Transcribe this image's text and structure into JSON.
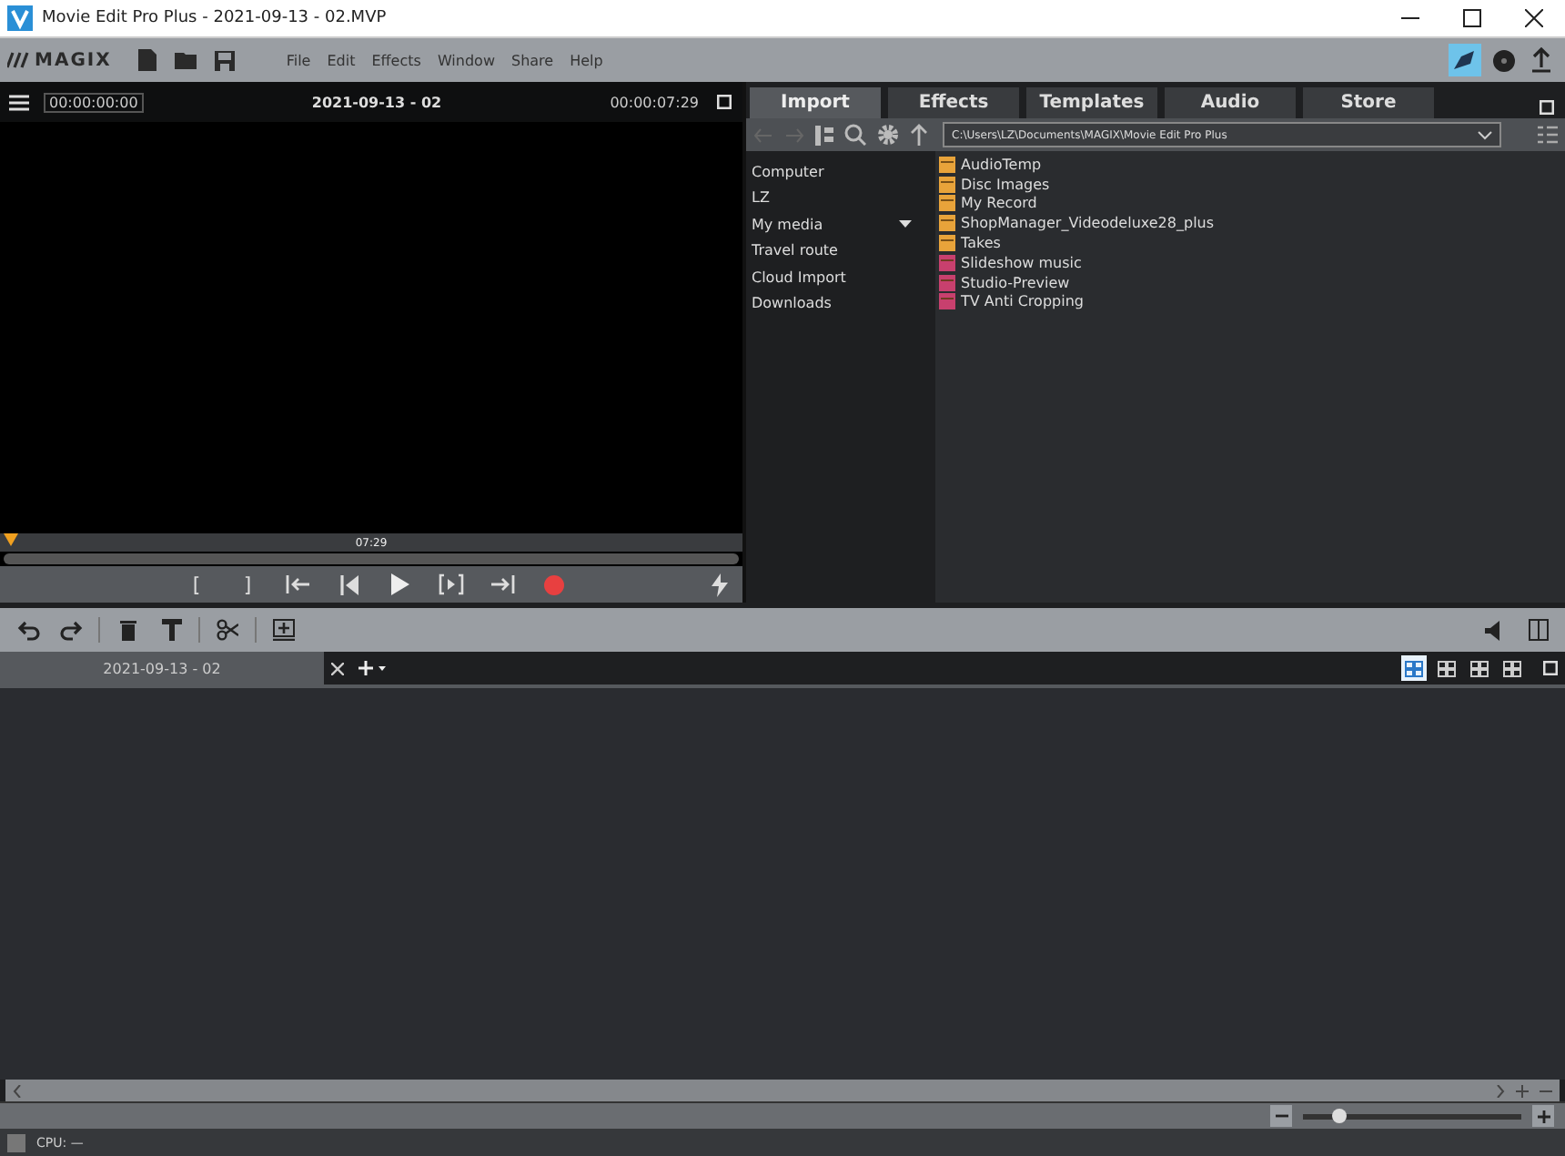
{
  "window": {
    "title": "Movie Edit Pro Plus - 2021-09-13 - 02.MVP"
  },
  "logo": "MAGIX",
  "menu": [
    "File",
    "Edit",
    "Effects",
    "Window",
    "Share",
    "Help"
  ],
  "preview": {
    "timecode_start": "00:00:00:00",
    "project": "2021-09-13 - 02",
    "timecode_end": "00:00:07:29",
    "ruler_label": "07:29",
    "transport": [
      {
        "kind": "text",
        "label": "["
      },
      {
        "kind": "text",
        "label": "]"
      },
      {
        "kind": "prev-marker"
      },
      {
        "kind": "start"
      },
      {
        "kind": "play"
      },
      {
        "kind": "play-range"
      },
      {
        "kind": "next-marker"
      },
      {
        "kind": "record"
      }
    ]
  },
  "media_tabs": [
    {
      "label": "Import",
      "selected": true
    },
    {
      "label": "Effects",
      "selected": false
    },
    {
      "label": "Templates",
      "selected": false
    },
    {
      "label": "Audio",
      "selected": false
    },
    {
      "label": "Store",
      "selected": false
    }
  ],
  "path": "C:\\Users\\LZ\\Documents\\MAGIX\\Movie Edit Pro Plus",
  "sidebar": {
    "items": [
      {
        "label": "Computer",
        "dropdown": false
      },
      {
        "label": "LZ",
        "dropdown": false
      },
      {
        "label": "My media",
        "dropdown": true
      },
      {
        "label": "Travel route",
        "dropdown": false
      },
      {
        "label": "Cloud Import",
        "dropdown": false
      },
      {
        "label": "Downloads",
        "dropdown": false
      }
    ]
  },
  "files": [
    {
      "name": "AudioTemp",
      "color": "#e8a33a"
    },
    {
      "name": "Disc Images",
      "color": "#e8a33a"
    },
    {
      "name": "My Record",
      "color": "#e8a33a"
    },
    {
      "name": "ShopManager_Videodeluxe28_plus",
      "color": "#e8a33a"
    },
    {
      "name": "Takes",
      "color": "#e8a33a"
    },
    {
      "name": "Slideshow music",
      "color": "#c8406e"
    },
    {
      "name": "Studio-Preview",
      "color": "#c8406e"
    },
    {
      "name": "TV Anti Cropping",
      "color": "#c8406e"
    }
  ],
  "project_tabs": [
    {
      "label": "2021-09-13 - 02",
      "selected": true
    }
  ],
  "view_modes": [
    {
      "selected": true
    },
    {
      "selected": false
    },
    {
      "selected": false
    },
    {
      "selected": false
    }
  ],
  "zoom": {
    "level": 0.17
  },
  "status_bar": {
    "cpu": "CPU: —"
  }
}
